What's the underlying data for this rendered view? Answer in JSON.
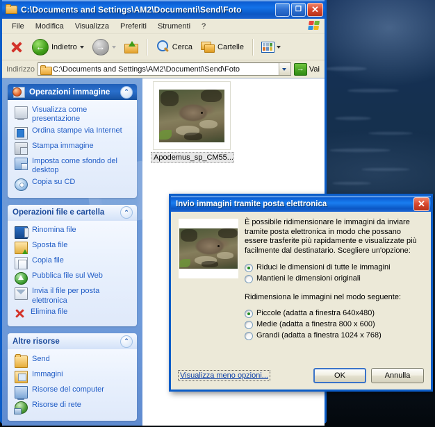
{
  "window": {
    "title": "C:\\Documents and Settings\\AM2\\Documenti\\Send\\Foto",
    "title_icon": "folder-icon",
    "controls": {
      "minimize": "_",
      "maximize": "❐",
      "close": "✕"
    },
    "menu": [
      "File",
      "Modifica",
      "Visualizza",
      "Preferiti",
      "Strumenti",
      "?"
    ],
    "toolbar": {
      "delete_label": "",
      "back_label": "Indietro",
      "forward_label": "",
      "up_label": "",
      "search_label": "Cerca",
      "folders_label": "Cartelle",
      "views_label": ""
    },
    "address": {
      "label": "Indirizzo",
      "value": "C:\\Documents and Settings\\AM2\\Documenti\\Send\\Foto",
      "go_label": "Vai"
    }
  },
  "sidebar": {
    "panels": [
      {
        "title": "Operazioni immagine",
        "style": "blue",
        "collapse_glyph": "⌃",
        "items": [
          {
            "label": "Visualizza come presentazione",
            "icon": "slideshow-icon"
          },
          {
            "label": "Ordina stampe via Internet",
            "icon": "order-prints-icon"
          },
          {
            "label": "Stampa immagine",
            "icon": "print-icon"
          },
          {
            "label": "Imposta come sfondo del desktop",
            "icon": "desktop-background-icon"
          },
          {
            "label": "Copia su CD",
            "icon": "cd-icon"
          }
        ]
      },
      {
        "title": "Operazioni file e cartella",
        "style": "light",
        "collapse_glyph": "⌃",
        "items": [
          {
            "label": "Rinomina file",
            "icon": "rename-icon"
          },
          {
            "label": "Sposta file",
            "icon": "move-icon"
          },
          {
            "label": "Copia file",
            "icon": "copy-icon"
          },
          {
            "label": "Pubblica file sul Web",
            "icon": "publish-web-icon"
          },
          {
            "label": "Invia il file per posta elettronica",
            "icon": "mail-icon"
          },
          {
            "label": "Elimina file",
            "icon": "delete-icon"
          }
        ]
      },
      {
        "title": "Altre risorse",
        "style": "light",
        "collapse_glyph": "⌃",
        "items": [
          {
            "label": "Send",
            "icon": "folder-icon"
          },
          {
            "label": "Immagini",
            "icon": "pictures-folder-icon"
          },
          {
            "label": "Risorse del computer",
            "icon": "my-computer-icon"
          },
          {
            "label": "Risorse di rete",
            "icon": "network-icon"
          }
        ]
      }
    ],
    "scrollbar": {
      "up_glyph": "⌃",
      "down_glyph": "⌄"
    }
  },
  "content": {
    "items": [
      {
        "filename": "Apodemus_sp_CM55...",
        "selected": true
      }
    ]
  },
  "dialog": {
    "title": "Invio immagini tramite posta elettronica",
    "close_glyph": "✕",
    "description": "È possibile ridimensionare le immagini da inviare tramite posta elettronica in modo che possano essere trasferite più rapidamente e visualizzate più facilmente dal destinatario. Scegliere un'opzione:",
    "mode_options": [
      {
        "label": "Riduci le dimensioni di tutte le immagini",
        "selected": true
      },
      {
        "label": "Mantieni le dimensioni originali",
        "selected": false
      }
    ],
    "resize_title": "Ridimensiona le immagini nel modo seguente:",
    "size_options": [
      {
        "label": "Piccole (adatta a finestra 640x480)",
        "selected": true
      },
      {
        "label": "Medie (adatta a finestra 800 x 600)",
        "selected": false
      },
      {
        "label": "Grandi (adatta a finestra 1024 x 768)",
        "selected": false
      }
    ],
    "less_options_link": "Visualizza meno opzioni...",
    "ok_label": "OK",
    "cancel_label": "Annulla"
  },
  "colors": {
    "title_blue": "#0b5ad0",
    "accent_link": "#215dc6",
    "panel_face": "#ece9d8",
    "sidebar_blue": "#6d99d6",
    "delete_red": "#d3332a",
    "radio_green": "#1f8a1f"
  }
}
